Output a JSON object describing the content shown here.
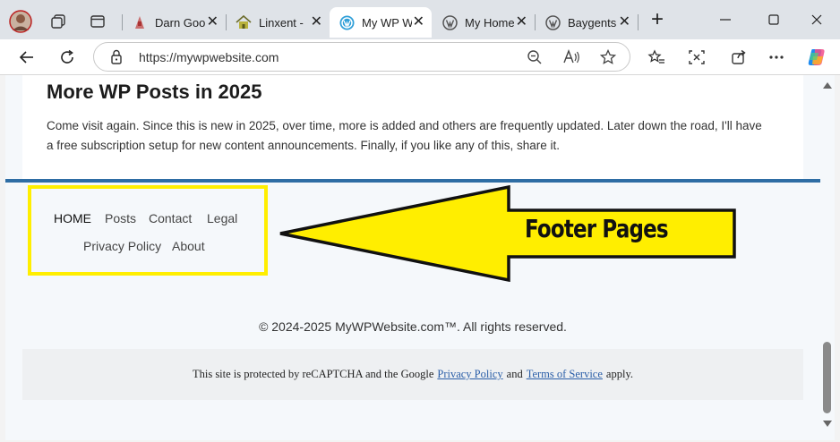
{
  "browser": {
    "tabs": [
      {
        "title": "Darn Goo",
        "favicon": "darn-goodies-icon",
        "active": false
      },
      {
        "title": "Linxent -",
        "favicon": "linxent-house-icon",
        "active": false
      },
      {
        "title": "My WP W",
        "favicon": "wordpress-icon",
        "active": true
      },
      {
        "title": "My Home",
        "favicon": "wordpress-icon",
        "active": false
      },
      {
        "title": "Baygents",
        "favicon": "wordpress-icon",
        "active": false
      }
    ],
    "close_glyph": "✕",
    "new_tab_glyph": "+",
    "url": "https://mywpwebsite.com"
  },
  "post": {
    "heading": "More WP Posts in 2025",
    "body": "Come visit again. Since this is new in 2025, over time, more is added and others are frequently updated. Later down the road, I'll have a free subscription setup for new content announcements. Finally, if you like any of this, share it."
  },
  "footer_nav": {
    "items": [
      "HOME",
      "Posts",
      "Contact",
      "Legal",
      "Privacy Policy",
      "About"
    ]
  },
  "annotation": {
    "label": "Footer Pages",
    "box_color": "#ffee00",
    "arrow_color": "#ffee00"
  },
  "copyright": "© 2024-2025 MyWPWebsite.com™.  All rights reserved.",
  "recaptcha": {
    "prefix": "This site is protected by reCAPTCHA and the Google",
    "privacy_link": "Privacy Policy",
    "middle": "and",
    "terms_link": "Terms of Service",
    "suffix": "apply."
  },
  "colors": {
    "accent_rule": "#2e6da4",
    "link": "#2a5ea8"
  }
}
